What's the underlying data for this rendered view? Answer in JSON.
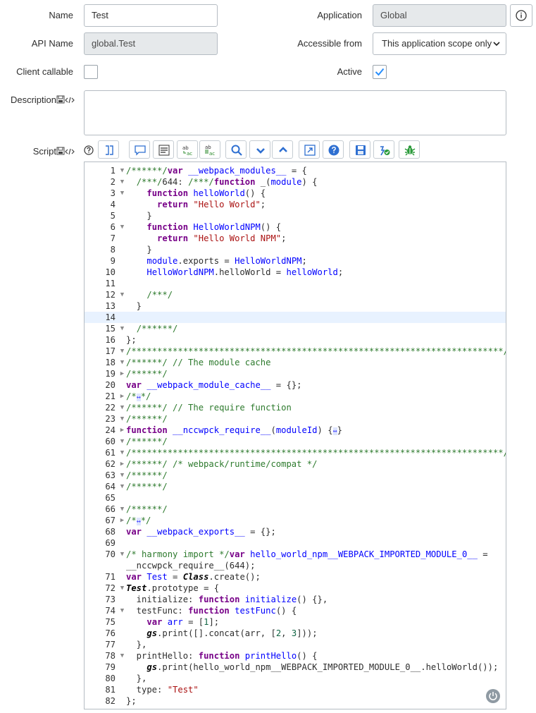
{
  "form": {
    "name_label": "Name",
    "name_value": "Test",
    "api_name_label": "API Name",
    "api_name_value": "global.Test",
    "client_callable_label": "Client callable",
    "client_callable_checked": false,
    "description_label": "Description",
    "description_value": "",
    "script_label": "Script",
    "application_label": "Application",
    "application_value": "Global",
    "accessible_from_label": "Accessible from",
    "accessible_from_value": "This application scope only",
    "active_label": "Active",
    "active_checked": true
  },
  "icons": {
    "info": "info-icon",
    "help": "help-icon",
    "script_tag": "script-tag-icon",
    "field_icon": "field-icon"
  },
  "colors": {
    "check_accent": "#278efc",
    "readonly_bg": "#e6e9eb",
    "keyword": "#770088",
    "definition": "#0000ff",
    "string": "#aa1111",
    "comment": "#2d7a2d"
  },
  "toolbar": [
    {
      "name": "format-code-button",
      "icon": "format-icon"
    },
    {
      "name": "comment-button",
      "icon": "comment-icon"
    },
    {
      "name": "uncomment-button",
      "icon": "uncomment-icon"
    },
    {
      "name": "replace-button",
      "icon": "replace-icon"
    },
    {
      "name": "replace-all-button",
      "icon": "replace-all-icon"
    },
    {
      "name": "search-button",
      "icon": "search-icon"
    },
    {
      "name": "find-next-button",
      "icon": "chevron-down-icon"
    },
    {
      "name": "find-previous-button",
      "icon": "chevron-up-icon"
    },
    {
      "name": "fullscreen-button",
      "icon": "expand-icon"
    },
    {
      "name": "help-button",
      "icon": "question-icon"
    },
    {
      "name": "save-button",
      "icon": "save-icon"
    },
    {
      "name": "check-syntax-button",
      "icon": "syntax-check-icon"
    },
    {
      "name": "debug-button",
      "icon": "debug-icon"
    }
  ],
  "editor": {
    "active_line": 14,
    "lines": [
      {
        "n": "1",
        "fold": "▼",
        "tokens": [
          [
            "cm",
            "/******/"
          ],
          [
            "kw",
            "var"
          ],
          [
            "",
            " "
          ],
          [
            "def",
            "__webpack_modules__"
          ],
          [
            "",
            " = {"
          ]
        ]
      },
      {
        "n": "2",
        "fold": "▼",
        "tokens": [
          [
            "",
            "  "
          ],
          [
            "cm",
            "/***/"
          ],
          [
            "",
            "644: "
          ],
          [
            "cm",
            "/***/"
          ],
          [
            "kw",
            "function"
          ],
          [
            "",
            " _("
          ],
          [
            "def",
            "module"
          ],
          [
            "",
            ") {"
          ]
        ]
      },
      {
        "n": "3",
        "fold": "▼",
        "tokens": [
          [
            "",
            "    "
          ],
          [
            "kw",
            "function"
          ],
          [
            "",
            " "
          ],
          [
            "def",
            "helloWorld"
          ],
          [
            "",
            "() {"
          ]
        ]
      },
      {
        "n": "4",
        "fold": "",
        "tokens": [
          [
            "",
            "      "
          ],
          [
            "kw",
            "return"
          ],
          [
            "",
            " "
          ],
          [
            "str",
            "\"Hello World\""
          ],
          [
            "",
            ";"
          ]
        ]
      },
      {
        "n": "5",
        "fold": "",
        "tokens": [
          [
            "",
            "    }"
          ]
        ]
      },
      {
        "n": "6",
        "fold": "▼",
        "tokens": [
          [
            "",
            "    "
          ],
          [
            "kw",
            "function"
          ],
          [
            "",
            " "
          ],
          [
            "def",
            "HelloWorldNPM"
          ],
          [
            "",
            "() {"
          ]
        ]
      },
      {
        "n": "7",
        "fold": "",
        "tokens": [
          [
            "",
            "      "
          ],
          [
            "kw",
            "return"
          ],
          [
            "",
            " "
          ],
          [
            "str",
            "\"Hello World NPM\""
          ],
          [
            "",
            ";"
          ]
        ]
      },
      {
        "n": "8",
        "fold": "",
        "tokens": [
          [
            "",
            "    }"
          ]
        ]
      },
      {
        "n": "9",
        "fold": "",
        "tokens": [
          [
            "",
            "    "
          ],
          [
            "def",
            "module"
          ],
          [
            "",
            ".exports = "
          ],
          [
            "def",
            "HelloWorldNPM"
          ],
          [
            "",
            ";"
          ]
        ]
      },
      {
        "n": "10",
        "fold": "",
        "tokens": [
          [
            "",
            "    "
          ],
          [
            "def",
            "HelloWorldNPM"
          ],
          [
            "",
            ".helloWorld = "
          ],
          [
            "def",
            "helloWorld"
          ],
          [
            "",
            ";"
          ]
        ]
      },
      {
        "n": "11",
        "fold": "",
        "tokens": [
          [
            "",
            ""
          ]
        ]
      },
      {
        "n": "12",
        "fold": "▼",
        "tokens": [
          [
            "",
            "    "
          ],
          [
            "cm",
            "/***/"
          ]
        ]
      },
      {
        "n": "13",
        "fold": "",
        "tokens": [
          [
            "",
            "  }"
          ]
        ]
      },
      {
        "n": "14",
        "fold": "",
        "tokens": [
          [
            "",
            ""
          ]
        ]
      },
      {
        "n": "15",
        "fold": "▼",
        "tokens": [
          [
            "",
            "  "
          ],
          [
            "cm",
            "/******/"
          ]
        ]
      },
      {
        "n": "16",
        "fold": "",
        "tokens": [
          [
            "",
            "};"
          ]
        ]
      },
      {
        "n": "17",
        "fold": "▼",
        "tokens": [
          [
            "cm",
            "/************************************************************************/"
          ]
        ]
      },
      {
        "n": "18",
        "fold": "▼",
        "tokens": [
          [
            "cm",
            "/******/ // The module cache"
          ]
        ]
      },
      {
        "n": "19",
        "fold": "▶",
        "tokens": [
          [
            "cm",
            "/******/"
          ]
        ]
      },
      {
        "n": "20",
        "fold": "",
        "tokens": [
          [
            "kw",
            "var"
          ],
          [
            "",
            " "
          ],
          [
            "def",
            "__webpack_module_cache__"
          ],
          [
            "",
            " = {};"
          ]
        ]
      },
      {
        "n": "21",
        "fold": "▶",
        "tokens": [
          [
            "cm",
            "/*"
          ],
          [
            "mk",
            "↔"
          ],
          [
            "cm",
            "*/"
          ]
        ]
      },
      {
        "n": "22",
        "fold": "▼",
        "tokens": [
          [
            "cm",
            "/******/ // The require function"
          ]
        ]
      },
      {
        "n": "23",
        "fold": "▼",
        "tokens": [
          [
            "cm",
            "/******/"
          ]
        ]
      },
      {
        "n": "24",
        "fold": "▶",
        "tokens": [
          [
            "kw",
            "function"
          ],
          [
            "",
            " "
          ],
          [
            "def",
            "__nccwpck_require__"
          ],
          [
            "",
            "("
          ],
          [
            "def",
            "moduleId"
          ],
          [
            "",
            ") {"
          ],
          [
            "mk",
            "↔"
          ],
          [
            "",
            "}"
          ]
        ]
      },
      {
        "n": "60",
        "fold": "▼",
        "tokens": [
          [
            "cm",
            "/******/"
          ]
        ]
      },
      {
        "n": "61",
        "fold": "▼",
        "tokens": [
          [
            "cm",
            "/************************************************************************/"
          ]
        ]
      },
      {
        "n": "62",
        "fold": "▶",
        "tokens": [
          [
            "cm",
            "/******/ /* webpack/runtime/compat */"
          ]
        ]
      },
      {
        "n": "63",
        "fold": "▼",
        "tokens": [
          [
            "cm",
            "/******/"
          ]
        ]
      },
      {
        "n": "64",
        "fold": "▼",
        "tokens": [
          [
            "cm",
            "/******/"
          ]
        ]
      },
      {
        "n": "65",
        "fold": "",
        "tokens": [
          [
            "",
            ""
          ]
        ]
      },
      {
        "n": "66",
        "fold": "▼",
        "tokens": [
          [
            "cm",
            "/******/"
          ]
        ]
      },
      {
        "n": "67",
        "fold": "▶",
        "tokens": [
          [
            "cm",
            "/*"
          ],
          [
            "mk",
            "↔"
          ],
          [
            "cm",
            "*/"
          ]
        ]
      },
      {
        "n": "68",
        "fold": "",
        "tokens": [
          [
            "kw",
            "var"
          ],
          [
            "",
            " "
          ],
          [
            "def",
            "__webpack_exports__"
          ],
          [
            "",
            " = {};"
          ]
        ]
      },
      {
        "n": "69",
        "fold": "",
        "tokens": [
          [
            "",
            ""
          ]
        ]
      },
      {
        "n": "70",
        "fold": "▼",
        "tokens": [
          [
            "cm",
            "/* harmony import */"
          ],
          [
            "kw",
            "var"
          ],
          [
            "",
            " "
          ],
          [
            "def",
            "hello_world_npm__WEBPACK_IMPORTED_MODULE_0__"
          ],
          [
            "",
            " ="
          ]
        ]
      },
      {
        "n": "",
        "fold": "",
        "tokens": [
          [
            "",
            "__nccwpck_require__(644);"
          ]
        ]
      },
      {
        "n": "71",
        "fold": "",
        "tokens": [
          [
            "kw",
            "var"
          ],
          [
            "",
            " "
          ],
          [
            "def",
            "Test"
          ],
          [
            "",
            " = "
          ],
          [
            "bi",
            "Class"
          ],
          [
            "",
            ".create();"
          ]
        ]
      },
      {
        "n": "72",
        "fold": "▼",
        "tokens": [
          [
            "bi",
            "Test"
          ],
          [
            "",
            ".prototype = {"
          ]
        ]
      },
      {
        "n": "73",
        "fold": "",
        "tokens": [
          [
            "",
            "  initialize: "
          ],
          [
            "kw",
            "function"
          ],
          [
            "",
            " "
          ],
          [
            "def",
            "initialize"
          ],
          [
            "",
            "() {},"
          ]
        ]
      },
      {
        "n": "74",
        "fold": "▼",
        "tokens": [
          [
            "",
            "  testFunc: "
          ],
          [
            "kw",
            "function"
          ],
          [
            "",
            " "
          ],
          [
            "def",
            "testFunc"
          ],
          [
            "",
            "() {"
          ]
        ]
      },
      {
        "n": "75",
        "fold": "",
        "tokens": [
          [
            "",
            "    "
          ],
          [
            "kw",
            "var"
          ],
          [
            "",
            " "
          ],
          [
            "def",
            "arr"
          ],
          [
            "",
            " = ["
          ],
          [
            "num",
            "1"
          ],
          [
            "",
            "];"
          ]
        ]
      },
      {
        "n": "76",
        "fold": "",
        "tokens": [
          [
            "",
            "    "
          ],
          [
            "bi",
            "gs"
          ],
          [
            "",
            ".print([].concat(arr, ["
          ],
          [
            "num",
            "2"
          ],
          [
            "",
            ", "
          ],
          [
            "num",
            "3"
          ],
          [
            "",
            "]));"
          ]
        ]
      },
      {
        "n": "77",
        "fold": "",
        "tokens": [
          [
            "",
            "  },"
          ]
        ]
      },
      {
        "n": "78",
        "fold": "▼",
        "tokens": [
          [
            "",
            "  printHello: "
          ],
          [
            "kw",
            "function"
          ],
          [
            "",
            " "
          ],
          [
            "def",
            "printHello"
          ],
          [
            "",
            "() {"
          ]
        ]
      },
      {
        "n": "79",
        "fold": "",
        "tokens": [
          [
            "",
            "    "
          ],
          [
            "bi",
            "gs"
          ],
          [
            "",
            ".print(hello_world_npm__WEBPACK_IMPORTED_MODULE_0__.helloWorld());"
          ]
        ]
      },
      {
        "n": "80",
        "fold": "",
        "tokens": [
          [
            "",
            "  },"
          ]
        ]
      },
      {
        "n": "81",
        "fold": "",
        "tokens": [
          [
            "",
            "  type: "
          ],
          [
            "str",
            "\"Test\""
          ]
        ]
      },
      {
        "n": "82",
        "fold": "",
        "tokens": [
          [
            "",
            "};"
          ]
        ]
      }
    ]
  }
}
